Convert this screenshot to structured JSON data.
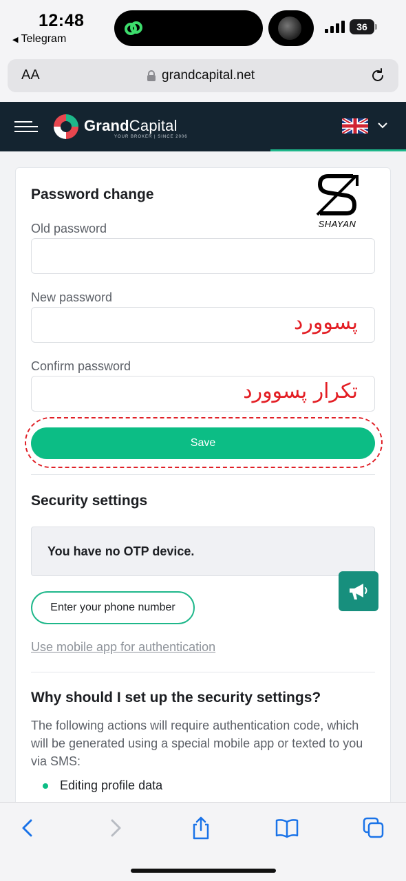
{
  "status_bar": {
    "time": "12:48",
    "back_app": "Telegram",
    "battery": "36"
  },
  "browser": {
    "text_size_label": "AA",
    "domain": "grandcapital.net"
  },
  "site_header": {
    "brand_bold": "Grand",
    "brand_light": "Capital",
    "brand_tagline": "YOUR BROKER | SINCE 2006",
    "language_flag": "uk-flag-icon"
  },
  "password_change": {
    "title": "Password change",
    "old_password_label": "Old password",
    "new_password_label": "New password",
    "new_password_annotation": "پسوورد",
    "confirm_password_label": "Confirm password",
    "confirm_password_annotation": "تکرار پسوورد",
    "save_label": "Save",
    "watermark_text": "SHAYAN"
  },
  "security": {
    "title": "Security settings",
    "otp_message": "You have no OTP device.",
    "phone_button_label": "Enter your phone number",
    "mobile_app_link": "Use mobile app for authentication"
  },
  "why_section": {
    "title": "Why should I set up the security settings?",
    "description": "The following actions will require authentication code, which will be generated using a special mobile app or texted to you via SMS:",
    "items": [
      "Editing profile data"
    ]
  },
  "colors": {
    "accent_green": "#0cbd85",
    "header_dark": "#142430",
    "annotation_red": "#e31e24",
    "fab_teal": "#178f7d"
  }
}
